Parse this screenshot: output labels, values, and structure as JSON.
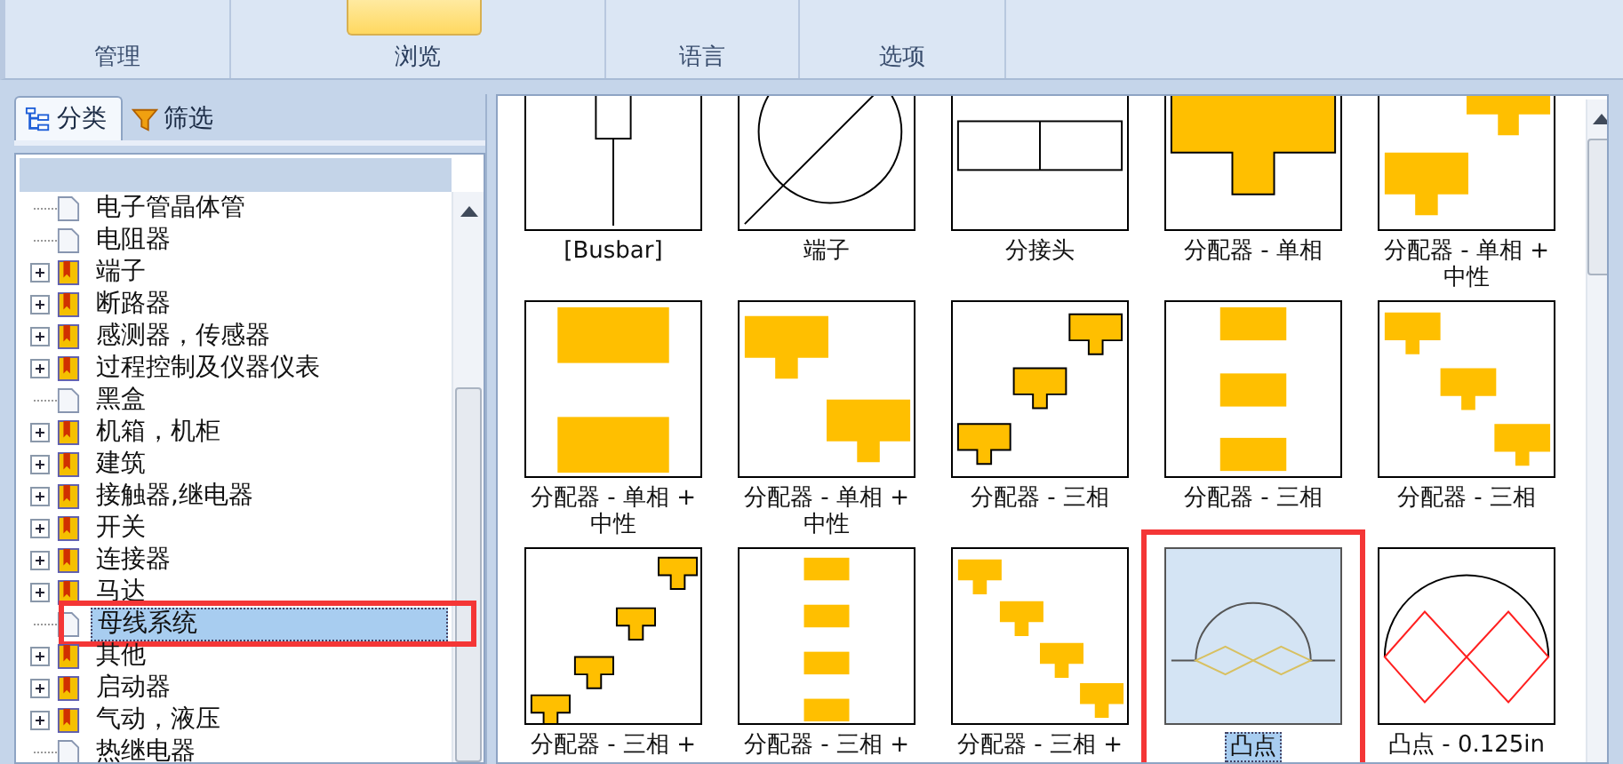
{
  "ribbon": {
    "tabs": [
      {
        "label": "管理",
        "selected": false
      },
      {
        "label": "浏览",
        "selected": true
      },
      {
        "label": "语言",
        "selected": false
      },
      {
        "label": "选项",
        "selected": false
      }
    ]
  },
  "sidebar": {
    "tabs": [
      {
        "label": "分类",
        "kind": "tree",
        "selected": true
      },
      {
        "label": "筛选",
        "kind": "filter",
        "selected": false
      }
    ],
    "tree": [
      {
        "label": "电子管晶体管",
        "kind": "leaf",
        "selected": false,
        "highlighted": false
      },
      {
        "label": "电阻器",
        "kind": "leaf",
        "selected": false,
        "highlighted": false
      },
      {
        "label": "端子",
        "kind": "folder",
        "selected": false,
        "highlighted": false
      },
      {
        "label": "断路器",
        "kind": "folder",
        "selected": false,
        "highlighted": false
      },
      {
        "label": "感测器，传感器",
        "kind": "folder",
        "selected": false,
        "highlighted": false
      },
      {
        "label": "过程控制及仪器仪表",
        "kind": "folder",
        "selected": false,
        "highlighted": false
      },
      {
        "label": "黑盒",
        "kind": "leaf",
        "selected": false,
        "highlighted": false
      },
      {
        "label": "机箱，机柜",
        "kind": "folder",
        "selected": false,
        "highlighted": false
      },
      {
        "label": "建筑",
        "kind": "folder",
        "selected": false,
        "highlighted": false
      },
      {
        "label": "接触器,继电器",
        "kind": "folder",
        "selected": false,
        "highlighted": false
      },
      {
        "label": "开关",
        "kind": "folder",
        "selected": false,
        "highlighted": false
      },
      {
        "label": "连接器",
        "kind": "folder",
        "selected": false,
        "highlighted": false
      },
      {
        "label": "马达",
        "kind": "folder",
        "selected": false,
        "highlighted": false
      },
      {
        "label": "母线系统",
        "kind": "leaf",
        "selected": true,
        "highlighted": true
      },
      {
        "label": "其他",
        "kind": "folder",
        "selected": false,
        "highlighted": false
      },
      {
        "label": "启动器",
        "kind": "folder",
        "selected": false,
        "highlighted": false
      },
      {
        "label": "气动，液压",
        "kind": "folder",
        "selected": false,
        "highlighted": false
      },
      {
        "label": "热继电器",
        "kind": "leaf",
        "selected": false,
        "highlighted": false
      }
    ]
  },
  "gallery": {
    "items": [
      {
        "label": "[Busbar]",
        "kind": "busbar",
        "selected": false,
        "highlighted": false
      },
      {
        "label": "端子",
        "kind": "terminal",
        "selected": false,
        "highlighted": false
      },
      {
        "label": "分接头",
        "kind": "tap",
        "selected": false,
        "highlighted": false
      },
      {
        "label": "分配器 - 单相",
        "kind": "dist-single",
        "selected": false,
        "highlighted": false
      },
      {
        "label": "分配器 - 单相 + 中性",
        "kind": "dist-single-neutral-diag",
        "selected": false,
        "highlighted": false
      },
      {
        "label": "分配器 - 单相 + 中性",
        "kind": "dist-single-neutral-bars",
        "selected": false,
        "highlighted": false
      },
      {
        "label": "分配器 - 单相 + 中性",
        "kind": "dist-single-neutral-tees",
        "selected": false,
        "highlighted": false
      },
      {
        "label": "分配器 - 三相",
        "kind": "dist-three-outlined",
        "selected": false,
        "highlighted": false
      },
      {
        "label": "分配器 - 三相",
        "kind": "dist-three-bars",
        "selected": false,
        "highlighted": false
      },
      {
        "label": "分配器 - 三相",
        "kind": "dist-three-diag",
        "selected": false,
        "highlighted": false
      },
      {
        "label": "分配器 - 三相 +",
        "kind": "dist-three-neutral-outlined",
        "selected": false,
        "highlighted": false
      },
      {
        "label": "分配器 - 三相 +",
        "kind": "dist-three-neutral-bars",
        "selected": false,
        "highlighted": false
      },
      {
        "label": "分配器 - 三相 +",
        "kind": "dist-three-neutral-diag",
        "selected": false,
        "highlighted": false
      },
      {
        "label": "凸点",
        "kind": "bump",
        "selected": true,
        "highlighted": true
      },
      {
        "label": "凸点 - 0.125in",
        "kind": "bump-red",
        "selected": false,
        "highlighted": false
      }
    ]
  }
}
